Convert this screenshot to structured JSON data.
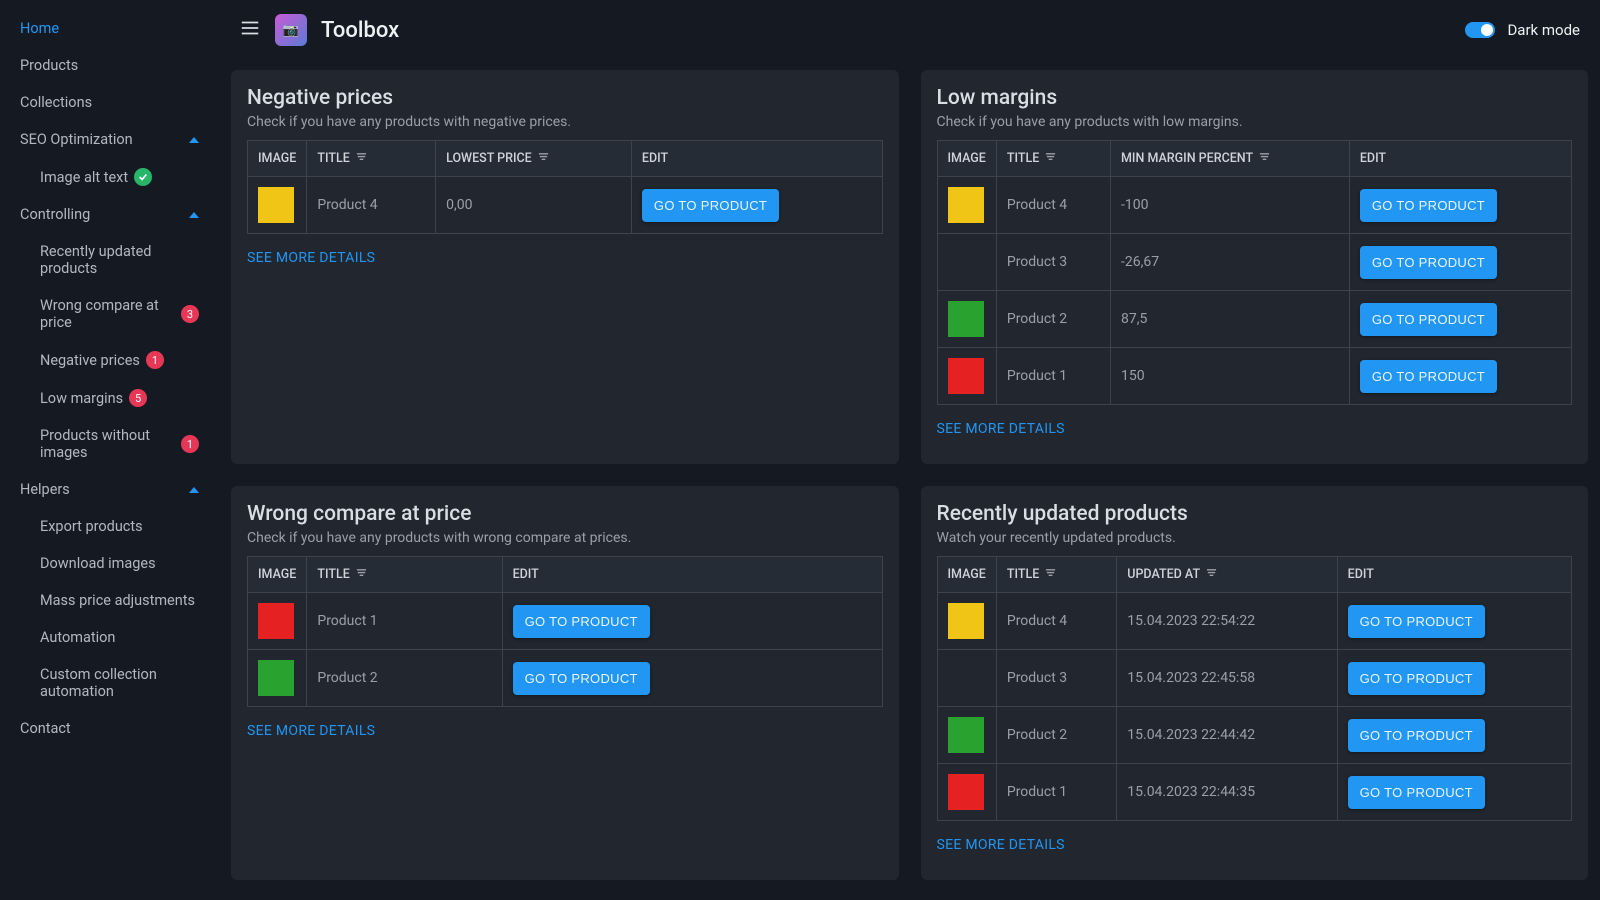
{
  "app": {
    "title": "Toolbox",
    "darkmode_label": "Dark mode"
  },
  "sidebar": {
    "home": "Home",
    "products": "Products",
    "collections": "Collections",
    "seo": "SEO Optimization",
    "seo_alt": "Image alt text",
    "controlling": "Controlling",
    "recently_updated": "Recently updated products",
    "wrong_compare": "Wrong compare at price",
    "wrong_compare_badge": "3",
    "negative_prices": "Negative prices",
    "negative_prices_badge": "1",
    "low_margins": "Low margins",
    "low_margins_badge": "5",
    "no_images": "Products without images",
    "no_images_badge": "1",
    "helpers": "Helpers",
    "export": "Export products",
    "download": "Download images",
    "mass": "Mass price adjustments",
    "automation": "Automation",
    "custom_auto": "Custom collection automation",
    "contact": "Contact"
  },
  "labels": {
    "image": "IMAGE",
    "title": "TITLE",
    "lowest_price": "LOWEST PRICE",
    "min_margin": "MIN MARGIN PERCENT",
    "updated_at": "UPDATED AT",
    "edit": "EDIT",
    "go_to_product": "GO TO PRODUCT",
    "see_more": "SEE MORE DETAILS"
  },
  "cards": {
    "neg": {
      "title": "Negative prices",
      "sub": "Check if you have any products with negative prices.",
      "rows": [
        {
          "color": "sw-yellow",
          "title": "Product 4",
          "price": "0,00"
        }
      ]
    },
    "low": {
      "title": "Low margins",
      "sub": "Check if you have any products with low margins.",
      "rows": [
        {
          "color": "sw-yellow",
          "title": "Product 4",
          "margin": "-100"
        },
        {
          "color": "",
          "title": "Product 3",
          "margin": "-26,67"
        },
        {
          "color": "sw-green",
          "title": "Product 2",
          "margin": "87,5"
        },
        {
          "color": "sw-red",
          "title": "Product 1",
          "margin": "150"
        }
      ]
    },
    "wrong": {
      "title": "Wrong compare at price",
      "sub": "Check if you have any products with wrong compare at prices.",
      "rows": [
        {
          "color": "sw-red",
          "title": "Product 1"
        },
        {
          "color": "sw-green",
          "title": "Product 2"
        }
      ]
    },
    "recent": {
      "title": "Recently updated products",
      "sub": "Watch your recently updated products.",
      "rows": [
        {
          "color": "sw-yellow",
          "title": "Product 4",
          "updated": "15.04.2023 22:54:22"
        },
        {
          "color": "",
          "title": "Product 3",
          "updated": "15.04.2023 22:45:58"
        },
        {
          "color": "sw-green",
          "title": "Product 2",
          "updated": "15.04.2023 22:44:42"
        },
        {
          "color": "sw-red",
          "title": "Product 1",
          "updated": "15.04.2023 22:44:35"
        }
      ]
    }
  }
}
